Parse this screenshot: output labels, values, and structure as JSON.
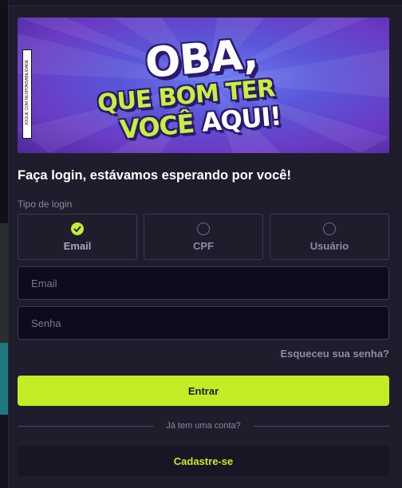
{
  "banner": {
    "line1": "OBA,",
    "line2a": "QUE BOM TER",
    "line3a": "VOCÊ",
    "line3b": "AQUI!",
    "badge_text": "JOGUE COM RESPONSABILIDADE",
    "colors": {
      "accent": "#c9ef3c",
      "background": "#5a56d8"
    }
  },
  "heading": "Faça login, estávamos esperando por você!",
  "login_type": {
    "label": "Tipo de login",
    "options": [
      {
        "label": "Email",
        "selected": true
      },
      {
        "label": "CPF",
        "selected": false
      },
      {
        "label": "Usuário",
        "selected": false
      }
    ]
  },
  "fields": {
    "email": {
      "placeholder": "Email",
      "value": ""
    },
    "senha": {
      "placeholder": "Senha",
      "value": ""
    }
  },
  "forgot_password": "Esqueceu sua senha?",
  "submit_label": "Entrar",
  "divider_text": "Já tem uma conta?",
  "register_label": "Cadastre-se",
  "colors": {
    "accent": "#c2ed25",
    "panel": "#1f1d2c",
    "input_bg": "#0f0b1e",
    "muted_text": "#8e8ba1"
  }
}
